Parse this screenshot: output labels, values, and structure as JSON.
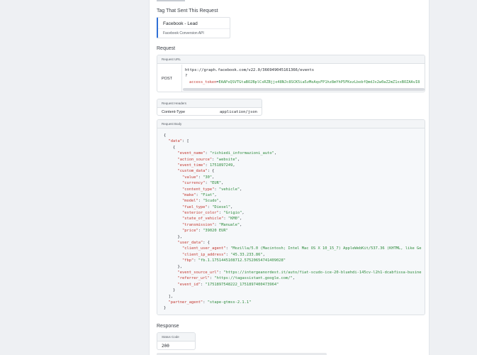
{
  "tag_section": {
    "label": "Tag That Sent This Request",
    "tag_name": "Facebook - Lead",
    "tag_type": "Facebook Conversion API"
  },
  "request_section": {
    "label": "Request",
    "url_box": {
      "header": "Request URL",
      "method": "POST",
      "url": "https://graph.facebook.com/v22.0/366949045161366/events",
      "query_mark": "?",
      "token_key": "access_token",
      "token_eq": "=",
      "token_value": "EAAPsQSVTGtaBO2BplCsRZBjjo48NJc8SCK5ia5zMeAqsFP1hz8mYhP5FKezLbebfQmdJx2w0aZ2mZ1xxBOZAAvI8"
    },
    "headers_box": {
      "header": "Request Headers",
      "key": "Content-Type",
      "value": "application/json"
    },
    "body_box": {
      "header": "Request Body",
      "lines": [
        [
          {
            "t": "p",
            "v": "{"
          }
        ],
        [
          {
            "t": "p",
            "v": "  "
          },
          {
            "t": "k",
            "v": "\"data\""
          },
          {
            "t": "p",
            "v": ": ["
          }
        ],
        [
          {
            "t": "p",
            "v": "    {"
          }
        ],
        [
          {
            "t": "p",
            "v": "      "
          },
          {
            "t": "k",
            "v": "\"event_name\""
          },
          {
            "t": "p",
            "v": ": "
          },
          {
            "t": "s",
            "v": "\"richiedi_informazioni_auto\""
          },
          {
            "t": "p",
            "v": ","
          }
        ],
        [
          {
            "t": "p",
            "v": "      "
          },
          {
            "t": "k",
            "v": "\"action_source\""
          },
          {
            "t": "p",
            "v": ": "
          },
          {
            "t": "s",
            "v": "\"website\""
          },
          {
            "t": "p",
            "v": ","
          }
        ],
        [
          {
            "t": "p",
            "v": "      "
          },
          {
            "t": "k",
            "v": "\"event_time\""
          },
          {
            "t": "p",
            "v": ": "
          },
          {
            "t": "n",
            "v": "1751897249"
          },
          {
            "t": "p",
            "v": ","
          }
        ],
        [
          {
            "t": "p",
            "v": "      "
          },
          {
            "t": "k",
            "v": "\"custom_data\""
          },
          {
            "t": "p",
            "v": ": {"
          }
        ],
        [
          {
            "t": "p",
            "v": "        "
          },
          {
            "t": "k",
            "v": "\"value\""
          },
          {
            "t": "p",
            "v": ": "
          },
          {
            "t": "s",
            "v": "\"30\""
          },
          {
            "t": "p",
            "v": ","
          }
        ],
        [
          {
            "t": "p",
            "v": "        "
          },
          {
            "t": "k",
            "v": "\"currency\""
          },
          {
            "t": "p",
            "v": ": "
          },
          {
            "t": "s",
            "v": "\"EUR\""
          },
          {
            "t": "p",
            "v": ","
          }
        ],
        [
          {
            "t": "p",
            "v": "        "
          },
          {
            "t": "k",
            "v": "\"content_type\""
          },
          {
            "t": "p",
            "v": ": "
          },
          {
            "t": "s",
            "v": "\"vehicle\""
          },
          {
            "t": "p",
            "v": ","
          }
        ],
        [
          {
            "t": "p",
            "v": "        "
          },
          {
            "t": "k",
            "v": "\"make\""
          },
          {
            "t": "p",
            "v": ": "
          },
          {
            "t": "s",
            "v": "\"Fiat\""
          },
          {
            "t": "p",
            "v": ","
          }
        ],
        [
          {
            "t": "p",
            "v": "        "
          },
          {
            "t": "k",
            "v": "\"model\""
          },
          {
            "t": "p",
            "v": ": "
          },
          {
            "t": "s",
            "v": "\"Scudo\""
          },
          {
            "t": "p",
            "v": ","
          }
        ],
        [
          {
            "t": "p",
            "v": "        "
          },
          {
            "t": "k",
            "v": "\"fuel_type\""
          },
          {
            "t": "p",
            "v": ": "
          },
          {
            "t": "s",
            "v": "\"Diesel\""
          },
          {
            "t": "p",
            "v": ","
          }
        ],
        [
          {
            "t": "p",
            "v": "        "
          },
          {
            "t": "k",
            "v": "\"exterior_color\""
          },
          {
            "t": "p",
            "v": ": "
          },
          {
            "t": "s",
            "v": "\"Grigio\""
          },
          {
            "t": "p",
            "v": ","
          }
        ],
        [
          {
            "t": "p",
            "v": "        "
          },
          {
            "t": "k",
            "v": "\"state_of_vehicle\""
          },
          {
            "t": "p",
            "v": ": "
          },
          {
            "t": "s",
            "v": "\"KM0\""
          },
          {
            "t": "p",
            "v": ","
          }
        ],
        [
          {
            "t": "p",
            "v": "        "
          },
          {
            "t": "k",
            "v": "\"transmission\""
          },
          {
            "t": "p",
            "v": ": "
          },
          {
            "t": "s",
            "v": "\"Manuale\""
          },
          {
            "t": "p",
            "v": ","
          }
        ],
        [
          {
            "t": "p",
            "v": "        "
          },
          {
            "t": "k",
            "v": "\"price\""
          },
          {
            "t": "p",
            "v": ": "
          },
          {
            "t": "s",
            "v": "\"39020 EUR\""
          }
        ],
        [
          {
            "t": "p",
            "v": "      },"
          }
        ],
        [
          {
            "t": "p",
            "v": "      "
          },
          {
            "t": "k",
            "v": "\"user_data\""
          },
          {
            "t": "p",
            "v": ": {"
          }
        ],
        [
          {
            "t": "p",
            "v": "        "
          },
          {
            "t": "k",
            "v": "\"client_user_agent\""
          },
          {
            "t": "p",
            "v": ": "
          },
          {
            "t": "s",
            "v": "\"Mozilla/5.0 (Macintosh; Intel Mac OS X 10_15_7) AppleWebKit/537.36 (KHTML, like Ge"
          }
        ],
        [
          {
            "t": "p",
            "v": "        "
          },
          {
            "t": "k",
            "v": "\"client_ip_address\""
          },
          {
            "t": "p",
            "v": ": "
          },
          {
            "t": "s",
            "v": "\"45.33.233.86\""
          },
          {
            "t": "p",
            "v": ","
          }
        ],
        [
          {
            "t": "p",
            "v": "        "
          },
          {
            "t": "k",
            "v": "\"fbp\""
          },
          {
            "t": "p",
            "v": ": "
          },
          {
            "t": "s",
            "v": "\"fb.1.1751445108712.57520654741409028\""
          }
        ],
        [
          {
            "t": "p",
            "v": "      },"
          }
        ],
        [
          {
            "t": "p",
            "v": "      "
          },
          {
            "t": "k",
            "v": "\"event_source_url\""
          },
          {
            "t": "p",
            "v": ": "
          },
          {
            "t": "s",
            "v": "\"https://intergeanordest.it/auto/fiat-scudo-ice-20-bluehdi-145cv-l2h1-dcabfissa-busine"
          }
        ],
        [
          {
            "t": "p",
            "v": "      "
          },
          {
            "t": "k",
            "v": "\"referrer_url\""
          },
          {
            "t": "p",
            "v": ": "
          },
          {
            "t": "s",
            "v": "\"https://tagassistant.google.com/\""
          },
          {
            "t": "p",
            "v": ","
          }
        ],
        [
          {
            "t": "p",
            "v": "      "
          },
          {
            "t": "k",
            "v": "\"event_id\""
          },
          {
            "t": "p",
            "v": ": "
          },
          {
            "t": "s",
            "v": "\"1751897548222_1751897400473964\""
          }
        ],
        [
          {
            "t": "p",
            "v": "    }"
          }
        ],
        [
          {
            "t": "p",
            "v": "  ],"
          }
        ],
        [
          {
            "t": "p",
            "v": "  "
          },
          {
            "t": "k",
            "v": "\"partner_agent\""
          },
          {
            "t": "p",
            "v": ": "
          },
          {
            "t": "s",
            "v": "\"stape-gtmss-2.1.1\""
          }
        ],
        [
          {
            "t": "p",
            "v": "}"
          }
        ]
      ]
    }
  },
  "response_section": {
    "label": "Response",
    "status_box": {
      "header": "Status Code",
      "value": "200"
    }
  },
  "colors": {
    "json_key": "#c2372f",
    "json_string": "#2e8b3d",
    "tag_accent": "#2f6fd6"
  }
}
